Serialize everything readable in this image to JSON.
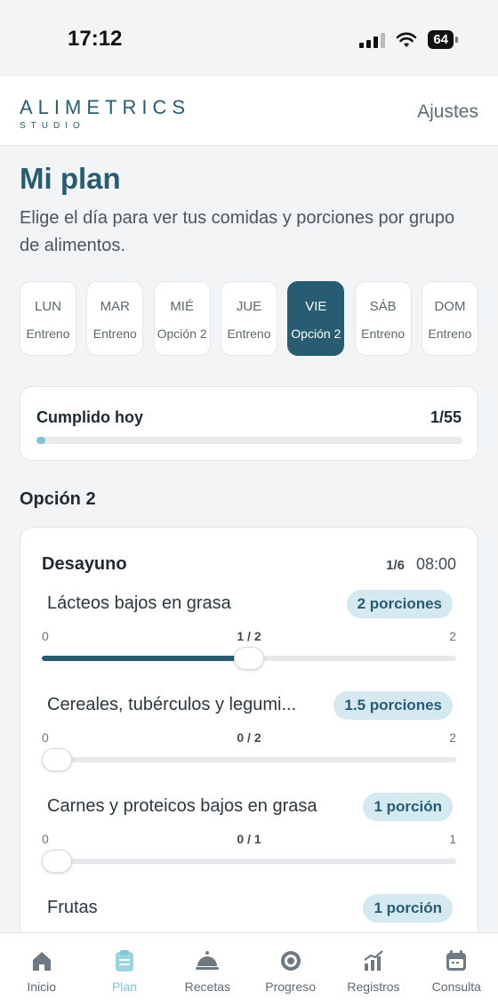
{
  "status": {
    "time": "17:12",
    "battery": "64"
  },
  "header": {
    "brand": "ALIMETRICS",
    "brand_sub": "STUDIO",
    "settings": "Ajustes"
  },
  "page": {
    "title": "Mi plan",
    "subtitle": "Elige el día para ver tus comidas y porciones por grupo de alimentos."
  },
  "days": [
    {
      "name": "LUN",
      "label": "Entreno",
      "active": false
    },
    {
      "name": "MAR",
      "label": "Entreno",
      "active": false
    },
    {
      "name": "MIÉ",
      "label": "Opción 2",
      "active": false
    },
    {
      "name": "JUE",
      "label": "Entreno",
      "active": false
    },
    {
      "name": "VIE",
      "label": "Opción 2",
      "active": true
    },
    {
      "name": "SÁB",
      "label": "Entreno",
      "active": false
    },
    {
      "name": "DOM",
      "label": "Entreno",
      "active": false
    }
  ],
  "progress": {
    "label": "Cumplido hoy",
    "count": "1/55",
    "fraction": 0.018
  },
  "section_title": "Opción 2",
  "meal": {
    "name": "Desayuno",
    "count": "1/6",
    "time": "08:00",
    "foods": [
      {
        "name": "Lácteos bajos en grasa",
        "badge": "2 porciones",
        "min": "0",
        "current": "1 / 2",
        "max": "2",
        "fraction": 0.5
      },
      {
        "name": "Cereales, tubérculos y legumi...",
        "badge": "1.5 porciones",
        "min": "0",
        "current": "0 / 2",
        "max": "2",
        "fraction": 0
      },
      {
        "name": "Carnes y proteicos bajos en grasa",
        "badge": "1 porción",
        "min": "0",
        "current": "0 / 1",
        "max": "1",
        "fraction": 0
      },
      {
        "name": "Frutas",
        "badge": "1 porción"
      }
    ]
  },
  "tabs": [
    {
      "label": "Inicio",
      "icon": "home-icon",
      "active": false
    },
    {
      "label": "Plan",
      "icon": "clipboard-icon",
      "active": true
    },
    {
      "label": "Recetas",
      "icon": "cloche-icon",
      "active": false
    },
    {
      "label": "Progreso",
      "icon": "target-icon",
      "active": false
    },
    {
      "label": "Registros",
      "icon": "chart-icon",
      "active": false
    },
    {
      "label": "Consulta",
      "icon": "calendar-icon",
      "active": false
    }
  ],
  "colors": {
    "primary": "#275c72",
    "accent": "#7fc7d4",
    "badge_bg": "#d4eaf0"
  }
}
